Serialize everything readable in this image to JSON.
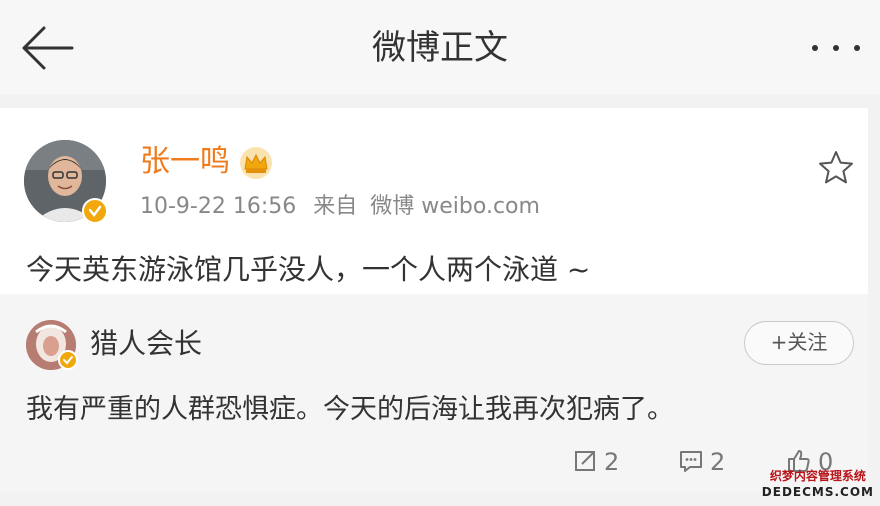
{
  "nav": {
    "title": "微博正文",
    "back_icon": "arrow-left-icon",
    "more_icon": "more-dots-icon"
  },
  "post": {
    "author": "张一鸣",
    "author_color": "#f07b1c",
    "badge_icon": "crown-icon",
    "verified_icon": "verified-badge-icon",
    "timestamp": "10-9-22 16:56",
    "source_prefix": "来自",
    "source": "微博 weibo.com",
    "text": "今天英东游泳馆几乎没人，一个人两个泳道 ~",
    "favorite_icon": "star-outline-icon"
  },
  "repost": {
    "author": "猎人会长",
    "follow_label": "+关注",
    "text": "我有严重的人群恐惧症。今天的后海让我再次犯病了。",
    "actions": {
      "repost_count": "2",
      "comment_count": "2",
      "like_count": "0"
    }
  },
  "watermark": {
    "line1": "织梦内容管理系统",
    "line2": "DEDECMS.COM"
  },
  "colors": {
    "accent_orange": "#f07b1c",
    "verified_gold": "#f1a80c",
    "page_bg": "#f2f2f2"
  }
}
